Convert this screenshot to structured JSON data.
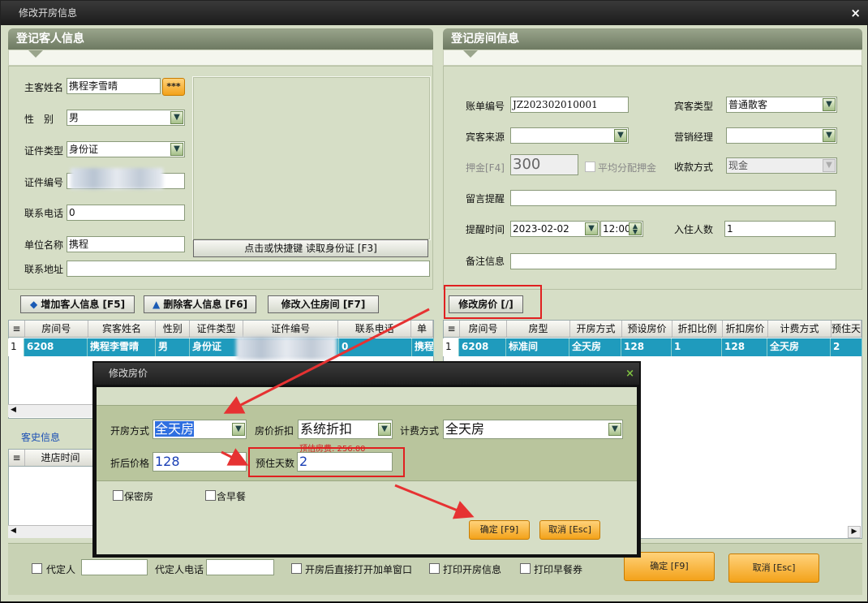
{
  "window": {
    "title": "修改开房信息",
    "close": "×"
  },
  "guest_panel": {
    "title": "登记客人信息",
    "name_label": "主客姓名",
    "name_value": "携程李雪晴",
    "name_btn": "***",
    "gender_label": "性　别",
    "gender_value": "男",
    "idtype_label": "证件类型",
    "idtype_value": "身份证",
    "idno_label": "证件编号",
    "phone_label": "联系电话",
    "phone_value": "0",
    "company_label": "单位名称",
    "company_value": "携程",
    "address_label": "联系地址",
    "read_id_btn": "点击或快捷键 读取身份证 [F3]"
  },
  "room_panel": {
    "title": "登记房间信息",
    "bill_label": "账单编号",
    "bill_value": "JZ202302010001",
    "guest_type_label": "宾客类型",
    "guest_type_value": "普通散客",
    "source_label": "宾客来源",
    "manager_label": "营销经理",
    "deposit_label": "押金[F4]",
    "deposit_value": "300",
    "avg_deposit_label": "平均分配押金",
    "pay_label": "收款方式",
    "pay_value": "现金",
    "msg_label": "留言提醒",
    "remind_label": "提醒时间",
    "remind_date": "2023-02-02",
    "remind_time": "12:00",
    "people_label": "入住人数",
    "people_value": "1",
    "note_label": "备注信息"
  },
  "toolbar": {
    "add_guest": "增加客人信息 [F5]",
    "del_guest": "删除客人信息 [F6]",
    "change_room": "修改入住房间 [F7]",
    "change_price": "修改房价 [/]"
  },
  "guest_grid": {
    "headers": [
      "房间号",
      "宾客姓名",
      "性别",
      "证件类型",
      "证件编号",
      "联系电话",
      "单"
    ],
    "row": {
      "n": "1",
      "room": "6208",
      "name": "携程李雪晴",
      "gender": "男",
      "idtype": "身份证",
      "phone": "0",
      "company": "携程"
    }
  },
  "room_grid": {
    "headers": [
      "房间号",
      "房型",
      "开房方式",
      "预设房价",
      "折扣比例",
      "折扣房价",
      "计费方式",
      "预住天"
    ],
    "row": {
      "n": "1",
      "room": "6208",
      "type": "标准间",
      "mode": "全天房",
      "preset": "128",
      "ratio": "1",
      "disc": "128",
      "billing": "全天房",
      "days": "2"
    }
  },
  "history": {
    "title": "客史信息",
    "col": "进店时间"
  },
  "footer": {
    "agent_label": "代定人",
    "agent_phone_label": "代定人电话",
    "open_bill_label": "开房后直接打开加单窗口",
    "print_open_label": "打印开房信息",
    "print_breakfast_label": "打印早餐券",
    "ok": "确定 [F9]",
    "cancel": "取消 [Esc]"
  },
  "dialog": {
    "title": "修改房价",
    "close": "×",
    "mode_label": "开房方式",
    "mode_value": "全天房",
    "discount_label": "房价折扣",
    "discount_value": "系统折扣",
    "billing_label": "计费方式",
    "billing_value": "全天房",
    "est_fee": "预估房费: 256.00",
    "price_label": "折后价格",
    "price_value": "128",
    "days_label": "预住天数",
    "days_value": "2",
    "secret_label": "保密房",
    "breakfast_label": "含早餐",
    "ok": "确定 [F9]",
    "cancel": "取消 [Esc]"
  },
  "colors": {
    "accent_row": "#1f9bbd",
    "highlight": "#e02020",
    "orange_btn": "#f3a21a"
  }
}
